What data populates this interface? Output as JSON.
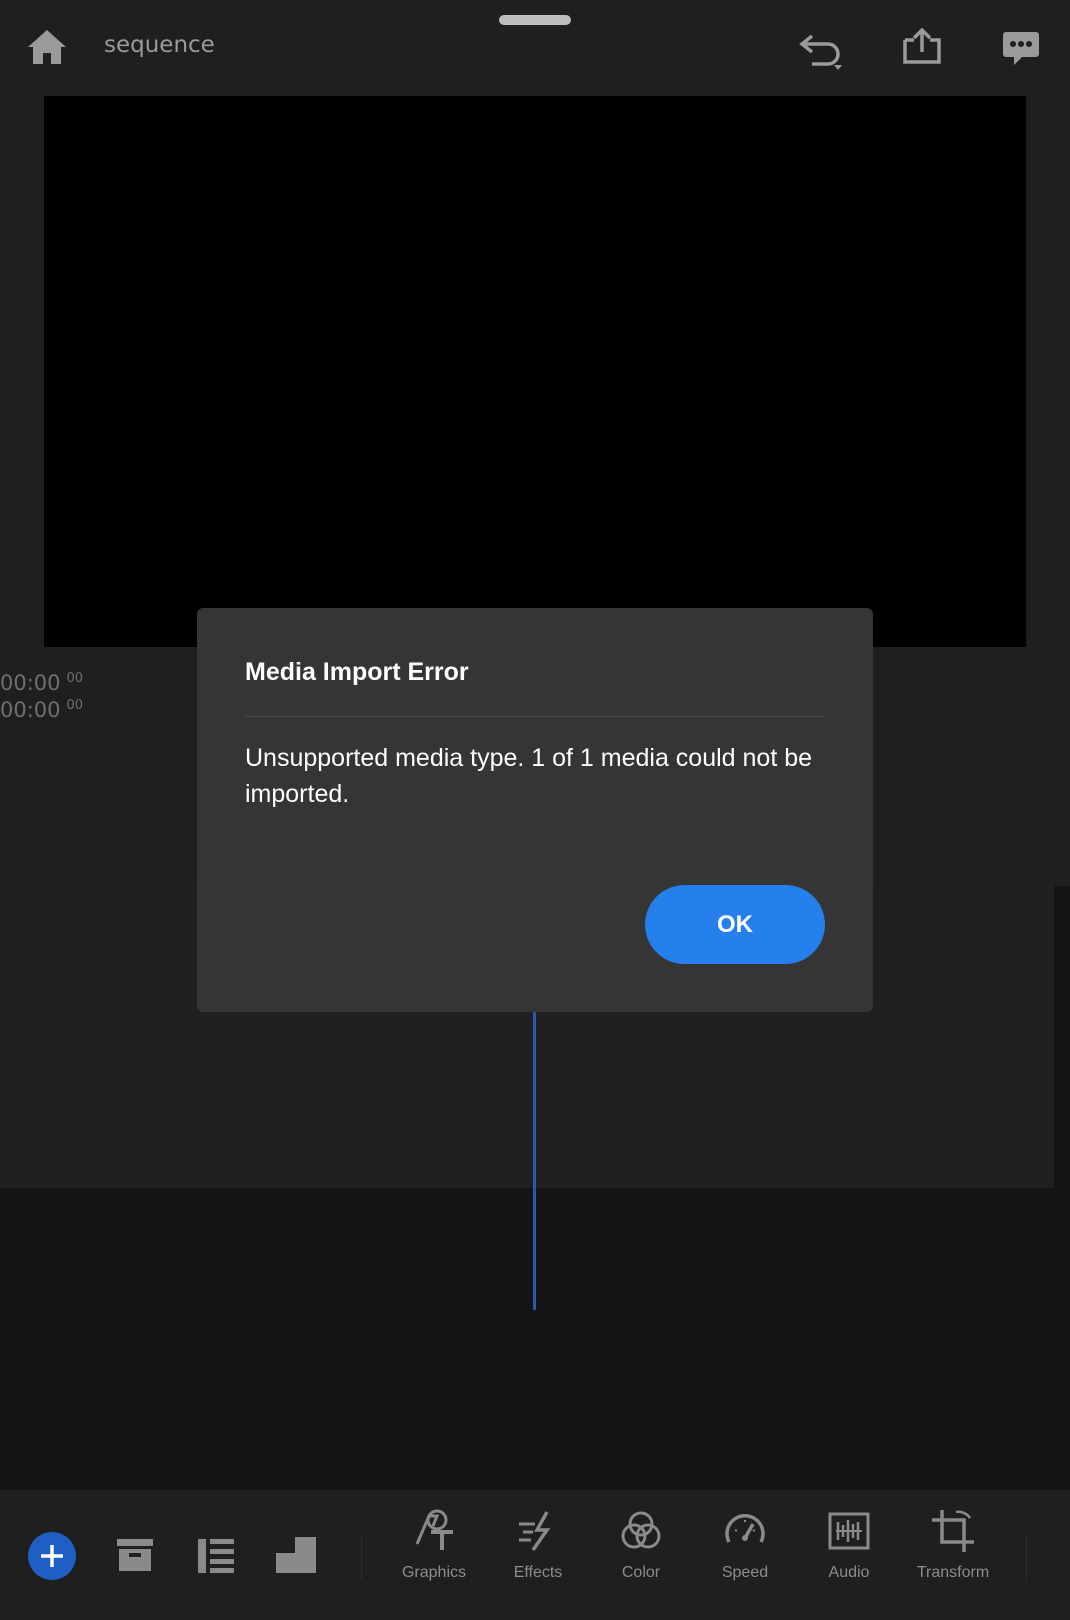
{
  "header": {
    "title": "sequence",
    "icons": [
      "home-icon",
      "undo-icon",
      "share-icon",
      "comments-icon"
    ]
  },
  "viewer": {
    "timecode_current": "00:00",
    "timecode_current_frames": "00",
    "timecode_duration": "00:00",
    "timecode_duration_frames": "00"
  },
  "dialog": {
    "title": "Media Import Error",
    "message": "Unsupported media type. 1 of 1 media could not be imported.",
    "ok_label": "OK"
  },
  "toolbar": {
    "tools": [
      {
        "label": "Graphics",
        "icon": "graphics-icon"
      },
      {
        "label": "Effects",
        "icon": "effects-icon"
      },
      {
        "label": "Color",
        "icon": "color-icon"
      },
      {
        "label": "Speed",
        "icon": "speed-icon"
      },
      {
        "label": "Audio",
        "icon": "audio-icon"
      },
      {
        "label": "Transform",
        "icon": "transform-icon"
      }
    ]
  },
  "colors": {
    "accent": "#2680eb",
    "add_button": "#1f5fc4",
    "playhead": "#2a5aa8",
    "dialog_bg": "#353535"
  }
}
